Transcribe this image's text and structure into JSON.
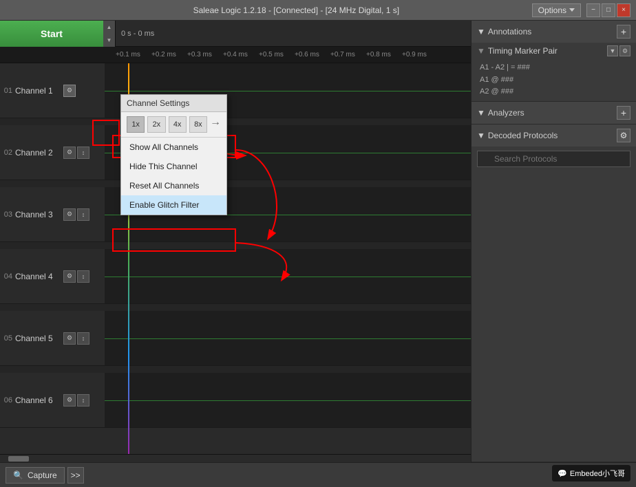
{
  "titleBar": {
    "title": "Saleae Logic 1.2.18 - [Connected] - [24 MHz Digital, 1 s]",
    "options": "Options",
    "minimize": "−",
    "maximize": "□",
    "close": "×"
  },
  "startButton": "Start",
  "timeline": {
    "zero": "0 s - 0 ms",
    "ticks": [
      "+0.1 ms",
      "+0.2 ms",
      "+0.3 ms",
      "+0.4 ms",
      "+0.5 ms",
      "+0.6 ms",
      "+0.7 ms",
      "+0.8 ms",
      "+0.9 ms"
    ]
  },
  "channels": [
    {
      "num": "01",
      "label": "Channel 1",
      "hasControls": true,
      "hasStretch": false
    },
    {
      "num": "02",
      "label": "Channel 2",
      "hasControls": true,
      "hasStretch": true
    },
    {
      "num": "03",
      "label": "Channel 3",
      "hasControls": true,
      "hasStretch": true
    },
    {
      "num": "04",
      "label": "Channel 4",
      "hasControls": true,
      "hasStretch": true
    },
    {
      "num": "05",
      "label": "Channel 5",
      "hasControls": true,
      "hasStretch": true
    },
    {
      "num": "06",
      "label": "Channel 6",
      "hasControls": true,
      "hasStretch": true
    }
  ],
  "contextMenu": {
    "title": "Channel Settings",
    "zoomButtons": [
      "1x",
      "2x",
      "4x",
      "8x"
    ],
    "activeZoom": 1,
    "items": [
      {
        "label": "Show All Channels",
        "highlighted": false
      },
      {
        "label": "Hide This Channel",
        "highlighted": false
      },
      {
        "label": "Reset All Channels",
        "highlighted": false
      },
      {
        "label": "Enable Glitch Filter",
        "highlighted": true
      }
    ]
  },
  "rightPanel": {
    "annotations": {
      "title": "Annotations",
      "timingMarkerPair": "Timing Marker Pair",
      "formula": "A1 - A2 | = ###",
      "a1": "A1  @  ###",
      "a2": "A2  @  ###"
    },
    "analyzers": {
      "title": "Analyzers"
    },
    "decodedProtocols": {
      "title": "Decoded Protocols",
      "gearLabel": "⚙",
      "searchPlaceholder": "Search Protocols"
    }
  },
  "bottomBar": {
    "captureLabel": "Capture",
    "searchIcon": "🔍",
    "arrowLabel": ">>"
  },
  "watermark": "Embeded小飞哥"
}
